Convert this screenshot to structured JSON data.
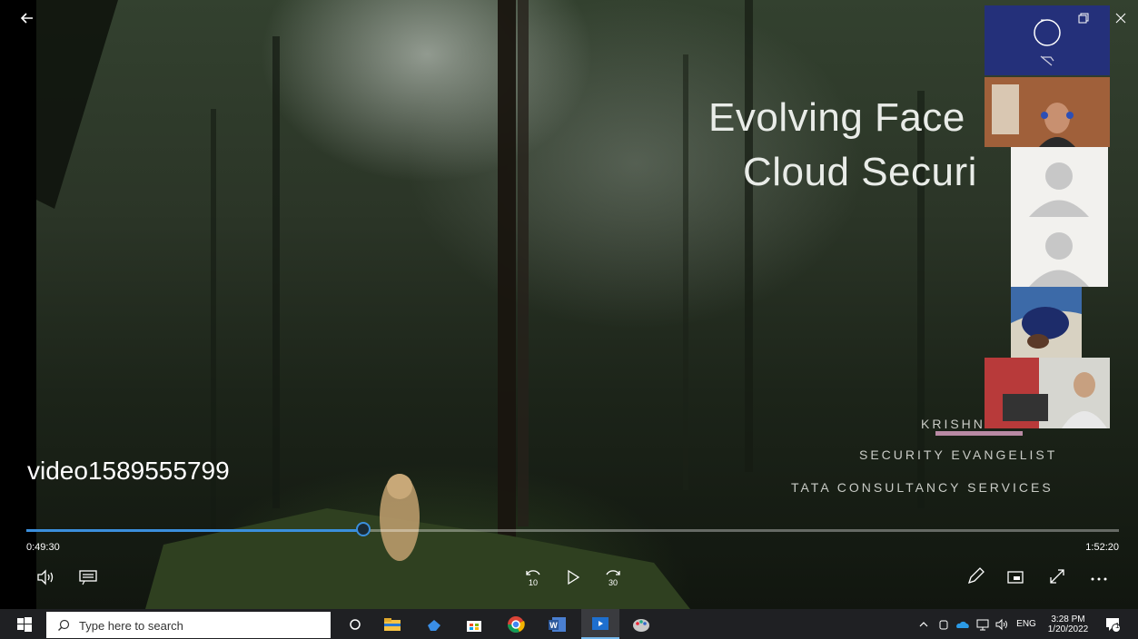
{
  "slide": {
    "title_line1": "Evolving Face",
    "title_line2": "Cloud Securi",
    "speaker_name": "KRISHN",
    "speaker_role": "SECURITY EVANGELIST",
    "speaker_company": "TATA CONSULTANCY SERVICES"
  },
  "player": {
    "video_name": "video1589555799",
    "current_time": "0:49:30",
    "total_time": "1:52:20",
    "progress": 0.3088
  },
  "icons": {
    "back": "back-arrow-icon",
    "volume": "volume-icon",
    "captions": "captions-icon",
    "rewind": "rewind-10-icon",
    "play": "play-icon",
    "forward": "forward-30-icon",
    "pen": "pen-icon",
    "miniview": "mini-view-icon",
    "fullscreen": "fullscreen-icon",
    "more": "more-icon"
  },
  "taskbar": {
    "search_placeholder": "Type here to search",
    "language": "ENG",
    "clock_time": "3:28 PM",
    "clock_date": "1/20/2022",
    "notification_count": "1"
  },
  "colors": {
    "accent": "#3b8fdc",
    "taskbar": "#1f2023",
    "underline": "#b98aa4"
  }
}
